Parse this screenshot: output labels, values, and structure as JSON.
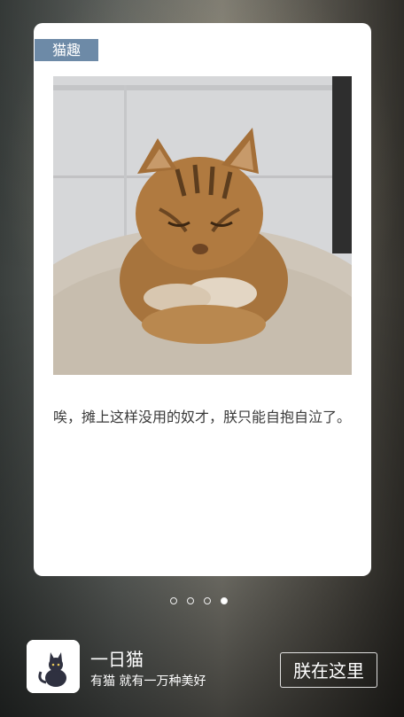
{
  "card": {
    "tag": "猫趣",
    "image": "orange tabby cat sitting on a cushion",
    "caption": "唉，摊上这样没用的奴才，朕只能自抱自泣了。"
  },
  "pager": {
    "count": 4,
    "active_index": 3
  },
  "footer": {
    "app_icon": "black-cat-icon",
    "app_name": "一日猫",
    "slogan": "有猫 就有一万种美好",
    "cta_label": "朕在这里"
  },
  "colors": {
    "tag_bg": "#6d8aa7",
    "card_bg": "#ffffff",
    "text": "#3a3a3a"
  }
}
